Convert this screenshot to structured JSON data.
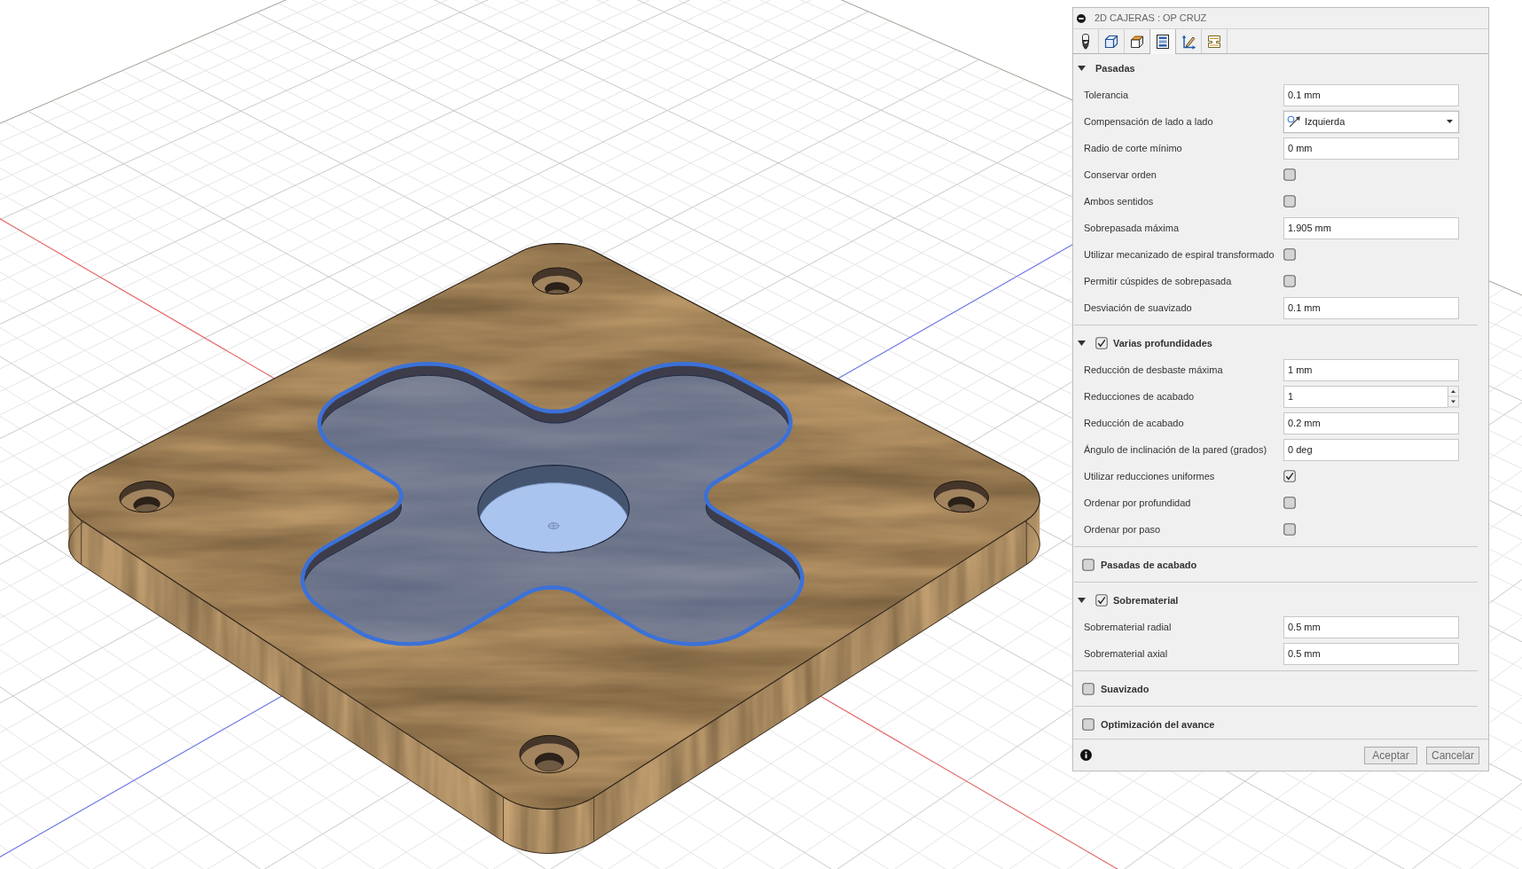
{
  "dialog": {
    "title": "2D CAJERAS : OP CRUZ",
    "tabs": [
      {
        "kind": "tool",
        "selected": false
      },
      {
        "kind": "geometry",
        "selected": false
      },
      {
        "kind": "heights",
        "selected": false
      },
      {
        "kind": "passes",
        "selected": true
      },
      {
        "kind": "linking",
        "selected": false
      },
      {
        "kind": "profile",
        "selected": false
      }
    ],
    "sections": [
      {
        "title": "Pasadas",
        "expanded": true,
        "rows": [
          {
            "kind": "input",
            "label": "Tolerancia",
            "value": "0.1 mm"
          },
          {
            "kind": "select",
            "label": "Compensación de lado a lado",
            "value": "Izquierda"
          },
          {
            "kind": "input",
            "label": "Radio de corte mínimo",
            "value": "0 mm"
          },
          {
            "kind": "checkbox",
            "label": "Conservar orden",
            "checked": false
          },
          {
            "kind": "checkbox",
            "label": "Ambos sentidos",
            "checked": false
          },
          {
            "kind": "input",
            "label": "Sobrepasada máxima",
            "value": "1.905 mm"
          },
          {
            "kind": "checkbox",
            "label": "Utilizar mecanizado de espiral transformado",
            "checked": false
          },
          {
            "kind": "checkbox",
            "label": "Permitir cúspides de sobrepasada",
            "checked": false
          },
          {
            "kind": "input",
            "label": "Desviación de suavizado",
            "value": "0.1 mm"
          }
        ]
      },
      {
        "title": "Varias profundidades",
        "expanded": true,
        "checked": true,
        "rows": [
          {
            "kind": "input",
            "label": "Reducción de desbaste máxima",
            "value": "1 mm"
          },
          {
            "kind": "spinner",
            "label": "Reducciones de acabado",
            "value": "1"
          },
          {
            "kind": "input",
            "label": "Reducción de acabado",
            "value": "0.2 mm"
          },
          {
            "kind": "input",
            "label": "Ángulo de inclinación de la pared (grados)",
            "value": "0 deg"
          },
          {
            "kind": "checkbox",
            "label": "Utilizar reducciones uniformes",
            "checked": true
          },
          {
            "kind": "checkbox",
            "label": "Ordenar por profundidad",
            "checked": false
          },
          {
            "kind": "checkbox",
            "label": "Ordenar por paso",
            "checked": false
          }
        ]
      },
      {
        "title": "Pasadas de acabado",
        "expanded": false,
        "checked": false
      },
      {
        "title": "Sobrematerial",
        "expanded": true,
        "checked": true,
        "rows": [
          {
            "kind": "input",
            "label": "Sobrematerial radial",
            "value": "0.5 mm"
          },
          {
            "kind": "input",
            "label": "Sobrematerial axial",
            "value": "0.5 mm"
          }
        ]
      },
      {
        "title": "Suavizado",
        "expanded": false,
        "checked": false
      },
      {
        "title": "Optimización del avance",
        "expanded": false,
        "checked": false
      }
    ],
    "buttons": [
      {
        "label": "Aceptar"
      },
      {
        "label": "Cancelar"
      }
    ]
  }
}
